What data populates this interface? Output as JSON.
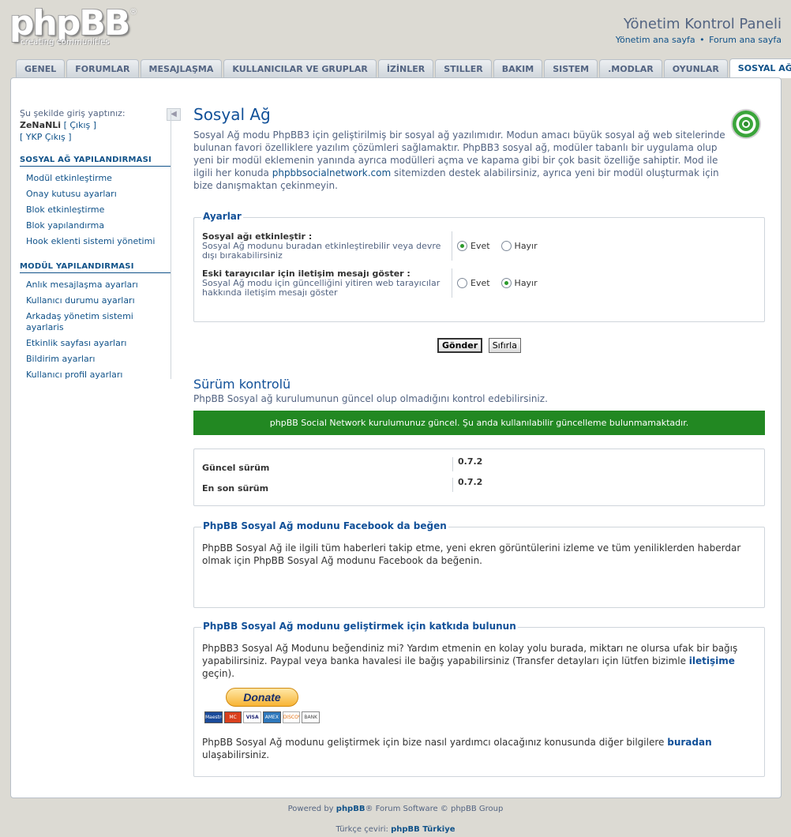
{
  "header": {
    "logo_text": "phpBB",
    "logo_tagline": "creating communities",
    "logo_reg": "®",
    "acp_title": "Yönetim Kontrol Paneli",
    "links": [
      "Yönetim ana sayfa",
      "Forum ana sayfa"
    ],
    "link_separator": "•"
  },
  "tabs": [
    {
      "label": "GENEL",
      "active": false
    },
    {
      "label": "FORUMLAR",
      "active": false
    },
    {
      "label": "MESAJLAŞMA",
      "active": false
    },
    {
      "label": "KULLANICILAR VE GRUPLAR",
      "active": false
    },
    {
      "label": "İZİNLER",
      "active": false
    },
    {
      "label": "STILLER",
      "active": false
    },
    {
      "label": "BAKIM",
      "active": false
    },
    {
      "label": "SISTEM",
      "active": false
    },
    {
      "label": ".MODLAR",
      "active": false
    },
    {
      "label": "OYUNLAR",
      "active": false
    },
    {
      "label": "SOSYAL AĞ",
      "active": true
    }
  ],
  "sidebar": {
    "logged_in_as": "Şu şekilde giriş yaptınız:",
    "username": "ZeNaNLi",
    "logout": "[ Çıkış ]",
    "acp_logout": "[ YKP Çıkış ]",
    "collapse_icon": "◀",
    "sections": [
      {
        "title": "SOSYAL AĞ YAPILANDIRMASI",
        "items": [
          "Modül etkinleştirme",
          "Onay kutusu ayarları",
          "Blok etkinleştirme",
          "Blok yapılandırma",
          "Hook eklenti sistemi yönetimi"
        ]
      },
      {
        "title": "MODÜL YAPILANDIRMASI",
        "items": [
          "Anlık mesajlaşma ayarları",
          "Kullanıcı durumu ayarları",
          "Arkadaş yönetim sistemi ayarlaris",
          "Etkinlik sayfası ayarları",
          "Bildirim ayarları",
          "Kullanıcı profil ayarları"
        ]
      }
    ]
  },
  "main": {
    "title": "Sosyal Ağ",
    "intro_before_link": "Sosyal Ağ modu PhpBB3 için geliştirilmiş bir sosyal ağ yazılımıdır. Modun amacı büyük sosyal ağ web sitelerinde bulunan favori özelliklere yazılım çözümleri sağlamaktır. PhpBB3 sosyal ağ, modüler tabanlı bir uygulama olup yeni bir modül eklemenin yanında ayrıca modülleri açma ve kapama gibi bir çok basit özelliğe sahiptir. Mod ile ilgili her konuda",
    "intro_link": "phpbbsocialnetwork.com",
    "intro_after_link": "sitemizden destek alabilirsiniz, ayrıca yeni bir modül oluşturmak için bize danışmaktan çekinmeyin.",
    "settings": {
      "legend": "Ayarlar",
      "rows": [
        {
          "title": "Sosyal ağı etkinleştir :",
          "desc": "Sosyal Ağ modunu buradan etkinleştirebilir veya devre dışı bırakabilirsiniz",
          "yes": "Evet",
          "no": "Hayır",
          "selected": "yes"
        },
        {
          "title": "Eski tarayıcılar için iletişim mesajı göster :",
          "desc": "Sosyal Ağ modu için güncelliğini yitiren web tarayıcılar hakkında iletişim mesajı göster",
          "yes": "Evet",
          "no": "Hayır",
          "selected": "no"
        }
      ],
      "submit": "Gönder",
      "reset": "Sıfırla"
    },
    "version": {
      "title": "Sürüm kontrolü",
      "desc": "PhpBB Sosyal ağ kurulumunun güncel olup olmadığını kontrol edebilirsiniz.",
      "status": "phpBB Social Network kurulumunuz güncel. Şu anda kullanılabilir güncelleme bulunmamaktadır.",
      "current_label": "Güncel sürüm",
      "current_value": "0.7.2",
      "latest_label": "En son sürüm",
      "latest_value": "0.7.2"
    },
    "facebook": {
      "legend": "PhpBB Sosyal Ağ modunu Facebook da beğen",
      "text": "PhpBB Sosyal Ağ ile ilgili tüm haberleri takip etme, yeni ekren görüntülerini izleme ve tüm yeniliklerden haberdar olmak için PhpBB Sosyal Ağ modunu Facebook da beğenin."
    },
    "contribute": {
      "legend": "PhpBB Sosyal Ağ modunu geliştirmek için katkıda bulunun",
      "text_before": "PhpBB3 Sosyal Ağ Modunu beğendiniz mi? Yardım etmenin en kolay yolu burada, miktarı ne olursa ufak bir bağış yapabilirsiniz. Paypal veya banka havalesi ile bağış yapabilirsiniz (Transfer detayları için lütfen bizimle",
      "text_link": "iletişime",
      "text_after": "geçin).",
      "donate_label": "Donate",
      "cards": [
        "Maestro",
        "MC",
        "VISA",
        "AMEX",
        "DISCOVER",
        "BANK"
      ],
      "footer_before": "PhpBB Sosyal Ağ modunu geliştirmek için bize nasıl yardımcı olacağınız konusunda diğer bilgilere",
      "footer_link": "buradan",
      "footer_after": "ulaşabilirsiniz."
    }
  },
  "footer": {
    "powered_before": "Powered by",
    "powered_link": "phpBB",
    "powered_after": "® Forum Software © phpBB Group",
    "translation_before": "Türkçe çeviri:",
    "translation_link": "phpBB Türkiye"
  },
  "colors": {
    "success_bg": "#228822",
    "link": "#105289",
    "heading": "#115098"
  }
}
